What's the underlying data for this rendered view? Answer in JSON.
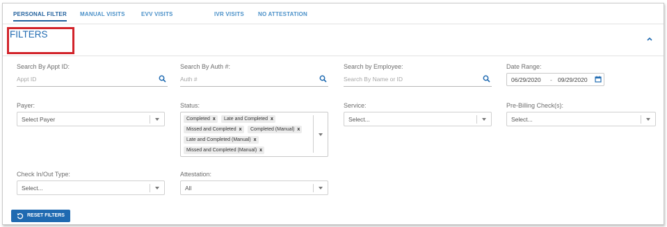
{
  "tabs": [
    {
      "label": "PERSONAL FILTER",
      "active": true
    },
    {
      "label": "MANUAL VISITS",
      "active": false
    },
    {
      "label": "EVV VISITS",
      "active": false
    },
    {
      "label": "IVR VISITS",
      "active": false
    },
    {
      "label": "NO ATTESTATION",
      "active": false
    }
  ],
  "filters": {
    "title": "FILTERS",
    "collapse_icon": "chevron-up-icon",
    "highlight_color": "#d2232a"
  },
  "fields": {
    "appt_id": {
      "label": "Search By Appt ID:",
      "placeholder": "Appt ID",
      "icon": "search-icon"
    },
    "auth": {
      "label": "Search By Auth #:",
      "placeholder": "Auth #",
      "icon": "search-icon"
    },
    "employee": {
      "label": "Search by Employee:",
      "placeholder": "Search By Name or ID",
      "icon": "search-icon"
    },
    "date_range": {
      "label": "Date Range:",
      "start": "06/29/2020",
      "separator": "-",
      "end": "09/29/2020",
      "icon": "calendar-icon"
    },
    "payer": {
      "label": "Payer:",
      "value": "Select Payer"
    },
    "status": {
      "label": "Status:",
      "chips": [
        "Completed",
        "Late and Completed",
        "Missed and Completed",
        "Completed (Manual)",
        "Late and Completed (Manual)",
        "Missed and Completed (Manual)"
      ],
      "remove_glyph": "x"
    },
    "service": {
      "label": "Service:",
      "value": "Select..."
    },
    "prebilling": {
      "label": "Pre-Billing Check(s):",
      "value": "Select..."
    },
    "check_type": {
      "label": "Check In/Out Type:",
      "value": "Select..."
    },
    "attestation": {
      "label": "Attestation:",
      "value": "All"
    }
  },
  "reset_button": {
    "label": "RESET FILTERS",
    "icon": "reset-icon"
  },
  "colors": {
    "accent": "#1f6ab1",
    "tab": "#4a90c8",
    "active_tab": "#1f5f9c"
  }
}
